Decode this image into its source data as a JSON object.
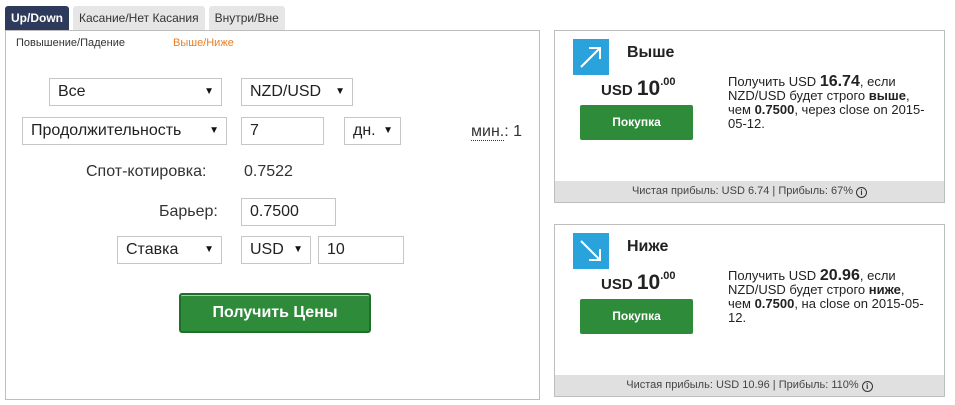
{
  "tabs": [
    "Up/Down",
    "Касание/Нет Касания",
    "Внутри/Вне"
  ],
  "subtabs": [
    "Повышение/Падение",
    "Выше/Ниже"
  ],
  "form": {
    "market": "Все",
    "symbol": "NZD/USD",
    "duration_type": "Продолжительность",
    "duration_value": "7",
    "duration_unit": "дн.",
    "min_label": "мин.",
    "min_value": ": 1",
    "spot_label": "Спот-котировка:",
    "spot_value": "0.7522",
    "barrier_label": "Барьер:",
    "barrier_value": "0.7500",
    "amount_type": "Ставка",
    "currency": "USD",
    "amount": "10",
    "get_prices": "Получить Цены"
  },
  "cards": [
    {
      "title": "Выше",
      "currency": "USD",
      "price_int": "10",
      "price_dec": ".00",
      "buy": "Покупка",
      "desc_pre": "Получить USD ",
      "payout": "16.74",
      "desc_mid": ", если NZD/USD будет строго ",
      "direction": "выше",
      "desc_mid2": ", чем ",
      "barrier": "0.7500",
      "desc_post": ", через close on 2015-05-12.",
      "foot": "Чистая прибыль: USD 6.74 | Прибыль: 67%"
    },
    {
      "title": "Ниже",
      "currency": "USD",
      "price_int": "10",
      "price_dec": ".00",
      "buy": "Покупка",
      "desc_pre": "Получить USD ",
      "payout": "20.96",
      "desc_mid": ", если NZD/USD будет строго ",
      "direction": "ниже",
      "desc_mid2": ", чем ",
      "barrier": "0.7500",
      "desc_post": ", на close on 2015-05-12.",
      "foot": "Чистая прибыль: USD 10.96 | Прибыль: 110%"
    }
  ],
  "colors": {
    "accent": "#2d3a5c",
    "buy": "#2e8b3a",
    "icon": "#2aa3dd",
    "subtab_active": "#e98024"
  }
}
